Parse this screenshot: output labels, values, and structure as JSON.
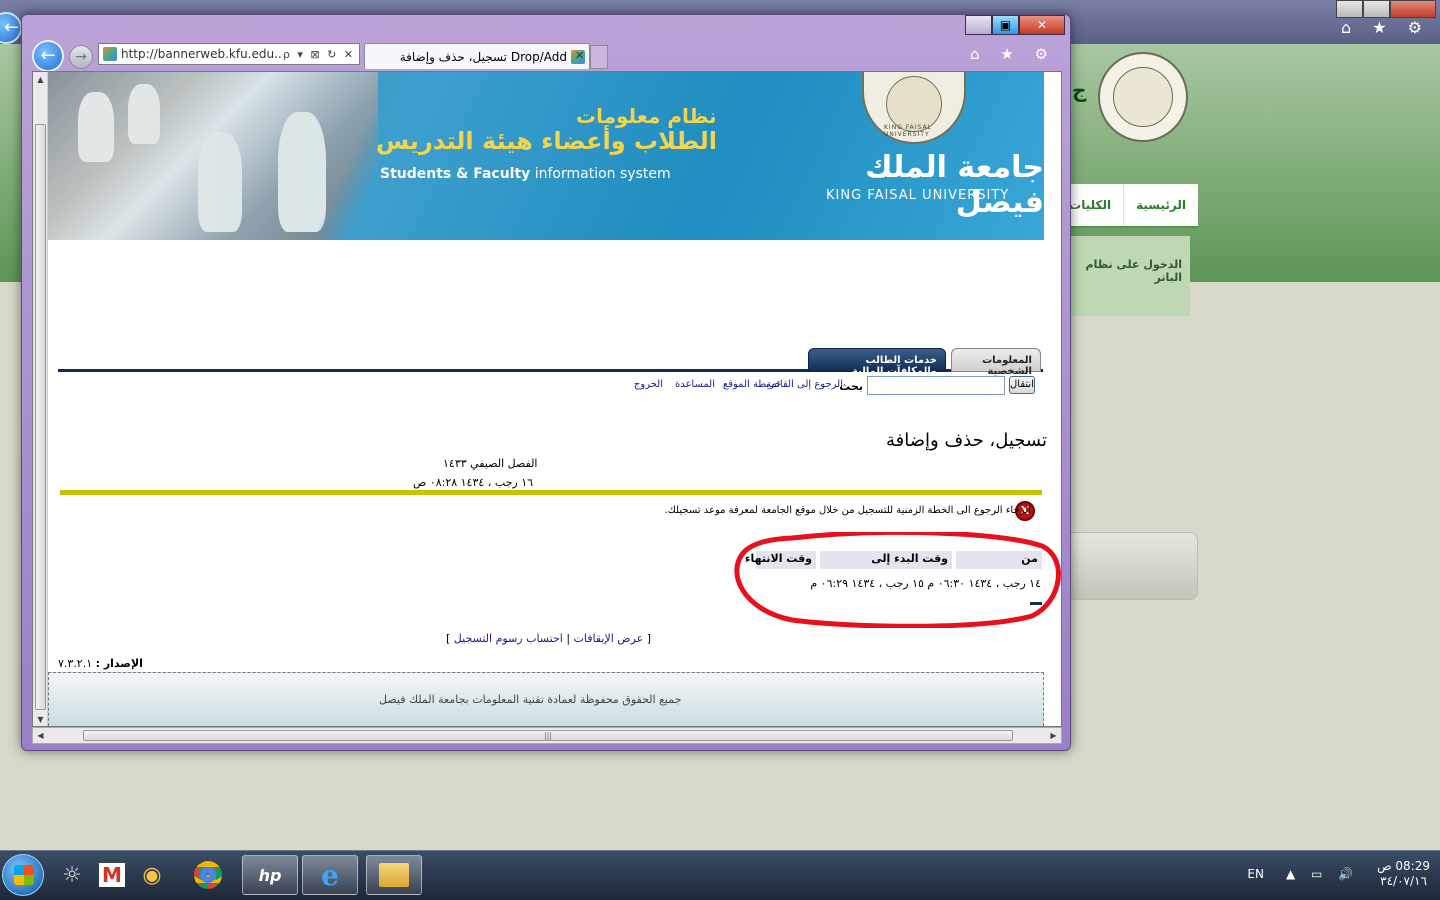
{
  "background_window": {
    "nav_items": [
      "الرئيسية",
      "الكليات"
    ],
    "side_panel_text": "الدخول على نظام الباتر",
    "logo_side_text": "ج"
  },
  "browser": {
    "address_url": "http://bannerweb.kfu.edu...",
    "address_tools": "ρ ▾ ⊠ ↻ ✕",
    "tab_title": "Drop/Add تسجيل، حذف وإضافة",
    "tab_close": "✕",
    "toolbar_icons": "⌂ ★ ⚙"
  },
  "banner": {
    "line1": "نظام معلومات",
    "line2": "الطلاب وأعضاء هيئة التدريس",
    "en_bold": "Students & Faculty",
    "en_rest": " information system",
    "university_ar": "جامعة الملك فيصل",
    "university_en": "KING FAISAL UNIVERSITY",
    "seal_text": "KING FAISAL UNIVERSITY"
  },
  "tabs": {
    "personal": "المعلومات الشخصية",
    "student_services": "خدمات الطالب والمكافآت المالية"
  },
  "nav": {
    "go_button": "انتقال",
    "search_label": "بحث",
    "links": {
      "back_to_menu": "الرجوع إلى القائمة",
      "site_map": "خريطة الموقع",
      "help": "المساعدة",
      "exit": "الخروج"
    }
  },
  "content": {
    "title": "تسجيل، حذف وإضافة",
    "term": "الفصل الصيفي ١٤٣٣",
    "date": "١٦ رجب ، ١٤٣٤ ٠٨:٢٨ ص",
    "error_icon": "X",
    "error_message": "الرجاء الرجوع الى الخطة الزمنية للتسجيل من خلال موقع الجامعة لمعرفة موعد تسجيلك.",
    "time_table": {
      "headers": {
        "from": "من",
        "start_time_to": "وقت البدء إلى",
        "end_time": "وقت الانتهاء"
      },
      "row": "١٤ رجب ، ١٤٣٤ ٠٦:٣٠ م  ١٥ رجب ، ١٤٣٤ ٠٦:٢٩ م"
    },
    "bottom_links": {
      "open_bracket": "[",
      "view_holds": "عرض الإيقافات",
      "separator": "|",
      "calc_fees": "احتساب رسوم التسجيل",
      "close_bracket": "]"
    },
    "version_label": "الإصدار :",
    "version_value": "٧.٣.٢.١",
    "footer": "جميع الحقوق محفوظة لعمادة تقنية المعلومات بجامعة الملك فيصل"
  },
  "taskbar": {
    "language": "EN",
    "tray_icons": "▲ ▭ 🔊",
    "clock_time": "08:29 ص",
    "clock_date": "٣٤/٠٧/١٦"
  },
  "colors": {
    "tab_active": "#102d54",
    "yellow_bar": "#c6c30b",
    "annotation": "#e8101e",
    "link": "#1a1a8c"
  }
}
